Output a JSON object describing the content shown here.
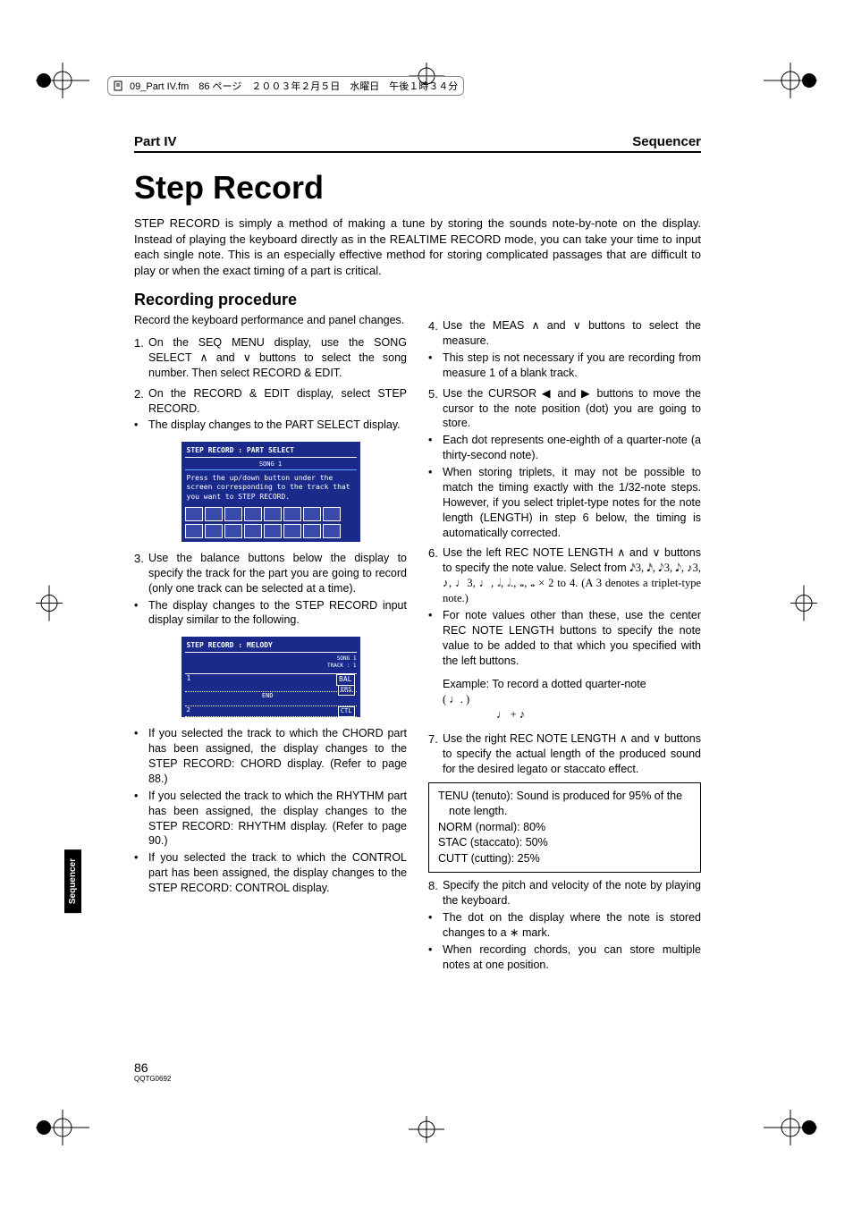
{
  "meta": {
    "file_header": "09_Part IV.fm　86 ページ　２００３年２月５日　水曜日　午後１時３４分"
  },
  "header": {
    "left": "Part IV",
    "right": "Sequencer"
  },
  "title": "Step Record",
  "intro": "STEP RECORD is simply a method of making a tune by storing the sounds note-by-note on the display. Instead of playing the keyboard directly as in the REALTIME RECORD mode, you can take your time to input each single note. This is an especially effective method for storing complicated passages that are difficult to play or when the exact timing of a part is critical.",
  "section_heading": "Recording procedure",
  "left": {
    "lead": "Record the keyboard performance and panel changes.",
    "step1": "On the SEQ MENU display, use the SONG SELECT ∧ and ∨ buttons to select the song number. Then select RECORD & EDIT.",
    "step2": "On the RECORD & EDIT display, select STEP RECORD.",
    "step2b": "The display changes to the PART SELECT display.",
    "shot1_title": "STEP RECORD : PART SELECT",
    "shot1_sub": "SONG 1",
    "shot1_body": "Press the up/down button under the screen corresponding to the track that you want to STEP RECORD.",
    "step3": "Use the balance buttons below the display to specify the track for the part you are going to record (only one track can be selected at a time).",
    "step3b": "The display changes to the STEP RECORD input display similar to the following.",
    "shot2_title": "STEP RECORD : MELODY",
    "b1": "If you selected the track to which the CHORD part has been assigned, the display changes to the STEP RECORD: CHORD display. (Refer to page 88.)",
    "b2": "If you selected the track to which the RHYTHM part has been assigned, the display changes to the STEP RECORD: RHYTHM display. (Refer to page 90.)",
    "b3": "If you selected the track to which the CONTROL part has been assigned, the display changes to the STEP RECORD: CONTROL display."
  },
  "right": {
    "step4": "Use the MEAS ∧ and ∨ buttons to select the measure.",
    "step4b": "This step is not necessary if you are recording from measure 1 of a blank track.",
    "step5": "Use the CURSOR ◀ and ▶ buttons to move the cursor to the note position (dot) you are going to store.",
    "step5b1": "Each dot represents one-eighth of a quarter-note (a thirty-second note).",
    "step5b2": "When storing triplets, it may not be possible to match the timing exactly with the 1/32-note steps. However, if you select triplet-type notes for the note length (LENGTH) in step 6 below, the timing is automatically corrected.",
    "step6": "Use the left REC NOTE LENGTH ∧ and ∨ buttons to specify the note value. Select from",
    "step6_notes": "𝅘𝅥𝅯3, 𝅘𝅥𝅯, 𝅘𝅥𝅮3, 𝅘𝅥𝅮, ♪3, ♪, ♩3, ♩, 𝅗𝅥, 𝅗𝅥., 𝅝, 𝅝 × 2 to 4. (A 3 denotes a triplet-type note.)",
    "step6b": "For note values other than these, use the center REC NOTE LENGTH buttons to specify the note value to be added to that which you specified with the left buttons.",
    "example_label": "Example: To record a dotted quarter-note",
    "example_paren": "( ♩. )",
    "example_sum": "♩ + ♪",
    "step7": "Use the right REC NOTE LENGTH ∧ and ∨ buttons to specify the actual length of the produced sound for the desired legato or staccato effect.",
    "box_l1": "TENU (tenuto): Sound is produced for 95% of the note length.",
    "box_l2": "NORM (normal): 80%",
    "box_l3": "STAC (staccato): 50%",
    "box_l4": "CUTT (cutting): 25%",
    "step8": "Specify the pitch and velocity of the note by playing the keyboard.",
    "step8b1": "The dot on the display where the note is stored changes to a ∗ mark.",
    "step8b2": "When recording chords, you can store multiple notes at one position."
  },
  "sidetab": "Sequencer",
  "footer": {
    "page": "86",
    "code": "QQTG0692"
  }
}
